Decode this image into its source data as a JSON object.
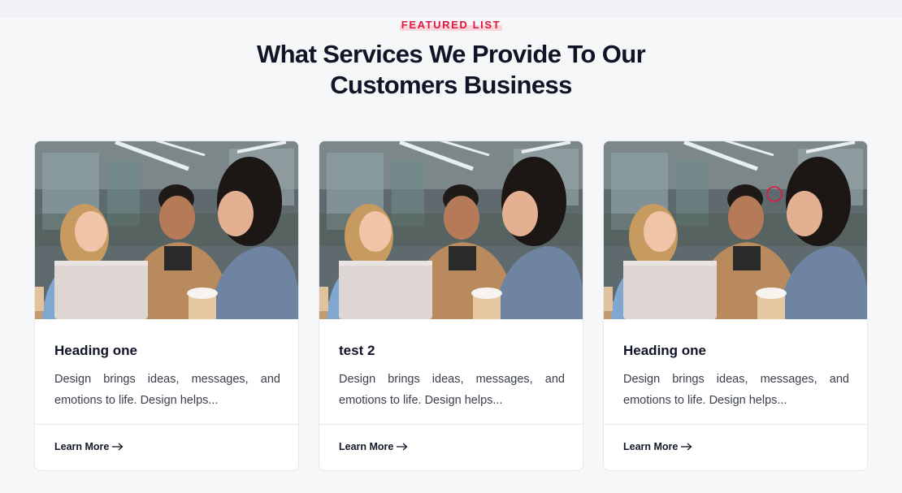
{
  "section": {
    "eyebrow": "FEATURED LIST",
    "headline_line1": "What Services We Provide To Our",
    "headline_line2": "Customers Business"
  },
  "cards": [
    {
      "title": "Heading one",
      "description": "Design brings ideas, messages, and emotions to life. Design helps...",
      "link_label": "Learn More",
      "link_icon": "arrow-right-icon",
      "image": "team-laptop-photo"
    },
    {
      "title": "test 2",
      "description": "Design brings ideas, messages, and emotions to life. Design helps...",
      "link_label": "Learn More",
      "link_icon": "arrow-right-icon",
      "image": "team-laptop-photo"
    },
    {
      "title": "Heading one",
      "description": "Design brings ideas, messages, and emotions to life. Design helps...",
      "link_label": "Learn More",
      "link_icon": "arrow-right-icon",
      "image": "team-laptop-photo"
    }
  ],
  "colors": {
    "accent": "#e4163c",
    "heading": "#0f1426",
    "background": "#f6f7f9"
  }
}
